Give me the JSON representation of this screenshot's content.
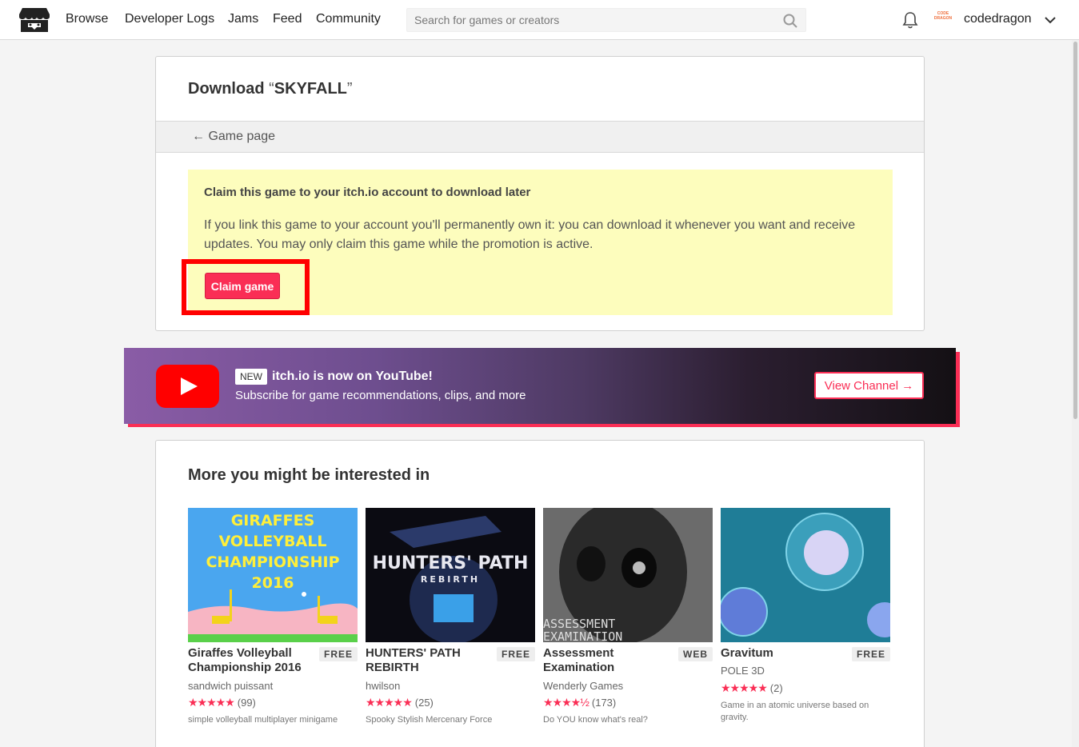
{
  "nav": {
    "items": [
      "Browse",
      "Developer Logs",
      "Jams",
      "Feed",
      "Community"
    ],
    "search_placeholder": "Search for games or creators",
    "username": "codedragon",
    "avatar_text": "CODE DRAGON"
  },
  "download": {
    "title_prefix": "Download ",
    "open_quote": "“",
    "game_name": "SKYFALL",
    "close_quote": "”",
    "back_link": "← Game page",
    "notice_title": "Claim this game to your itch.io account to download later",
    "notice_body": "If you link this game to your account you'll permanently own it: you can download it whenever you want and receive updates. You may only claim this game while the promotion is active.",
    "claim_button": "Claim game"
  },
  "banner": {
    "badge": "NEW",
    "title": "itch.io is now on YouTube!",
    "subtitle": "Subscribe for game recommendations, clips, and more",
    "button": "View Channel →"
  },
  "recommendations": {
    "heading": "More you might be interested in",
    "games": [
      {
        "title": "Giraffes Volleyball Championship 2016",
        "price": "FREE",
        "author": "sandwich puissant",
        "stars": "★★★★★",
        "rating_count": "(99)",
        "description": "simple volleyball multiplayer minigame",
        "thumb_text": [
          "GIRAFFES",
          "VOLLEYBALL",
          "CHAMPIONSHIP",
          "2016"
        ]
      },
      {
        "title": "HUNTERS' PATH REBIRTH",
        "price": "FREE",
        "author": "hwilson",
        "stars": "★★★★★",
        "rating_count": "(25)",
        "description": "Spooky Stylish Mercenary Force",
        "thumb_text": [
          "HUNTERS' PATH",
          "REBIRTH"
        ]
      },
      {
        "title": "Assessment Examination",
        "price": "WEB",
        "author": "Wenderly Games",
        "stars": "★★★★½",
        "rating_count": "(173)",
        "description": "Do YOU know what's real?",
        "thumb_text": [
          "ASSESSMENT",
          "EXAMINATION"
        ]
      },
      {
        "title": "Gravitum",
        "price": "FREE",
        "author": "POLE 3D",
        "stars": "★★★★★",
        "rating_count": "(2)",
        "description": "Game in an atomic universe based on gravity."
      }
    ]
  },
  "colors": {
    "accent": "#fa2e55",
    "notice_bg": "#fdfdbd",
    "highlight": "#ff0000"
  }
}
